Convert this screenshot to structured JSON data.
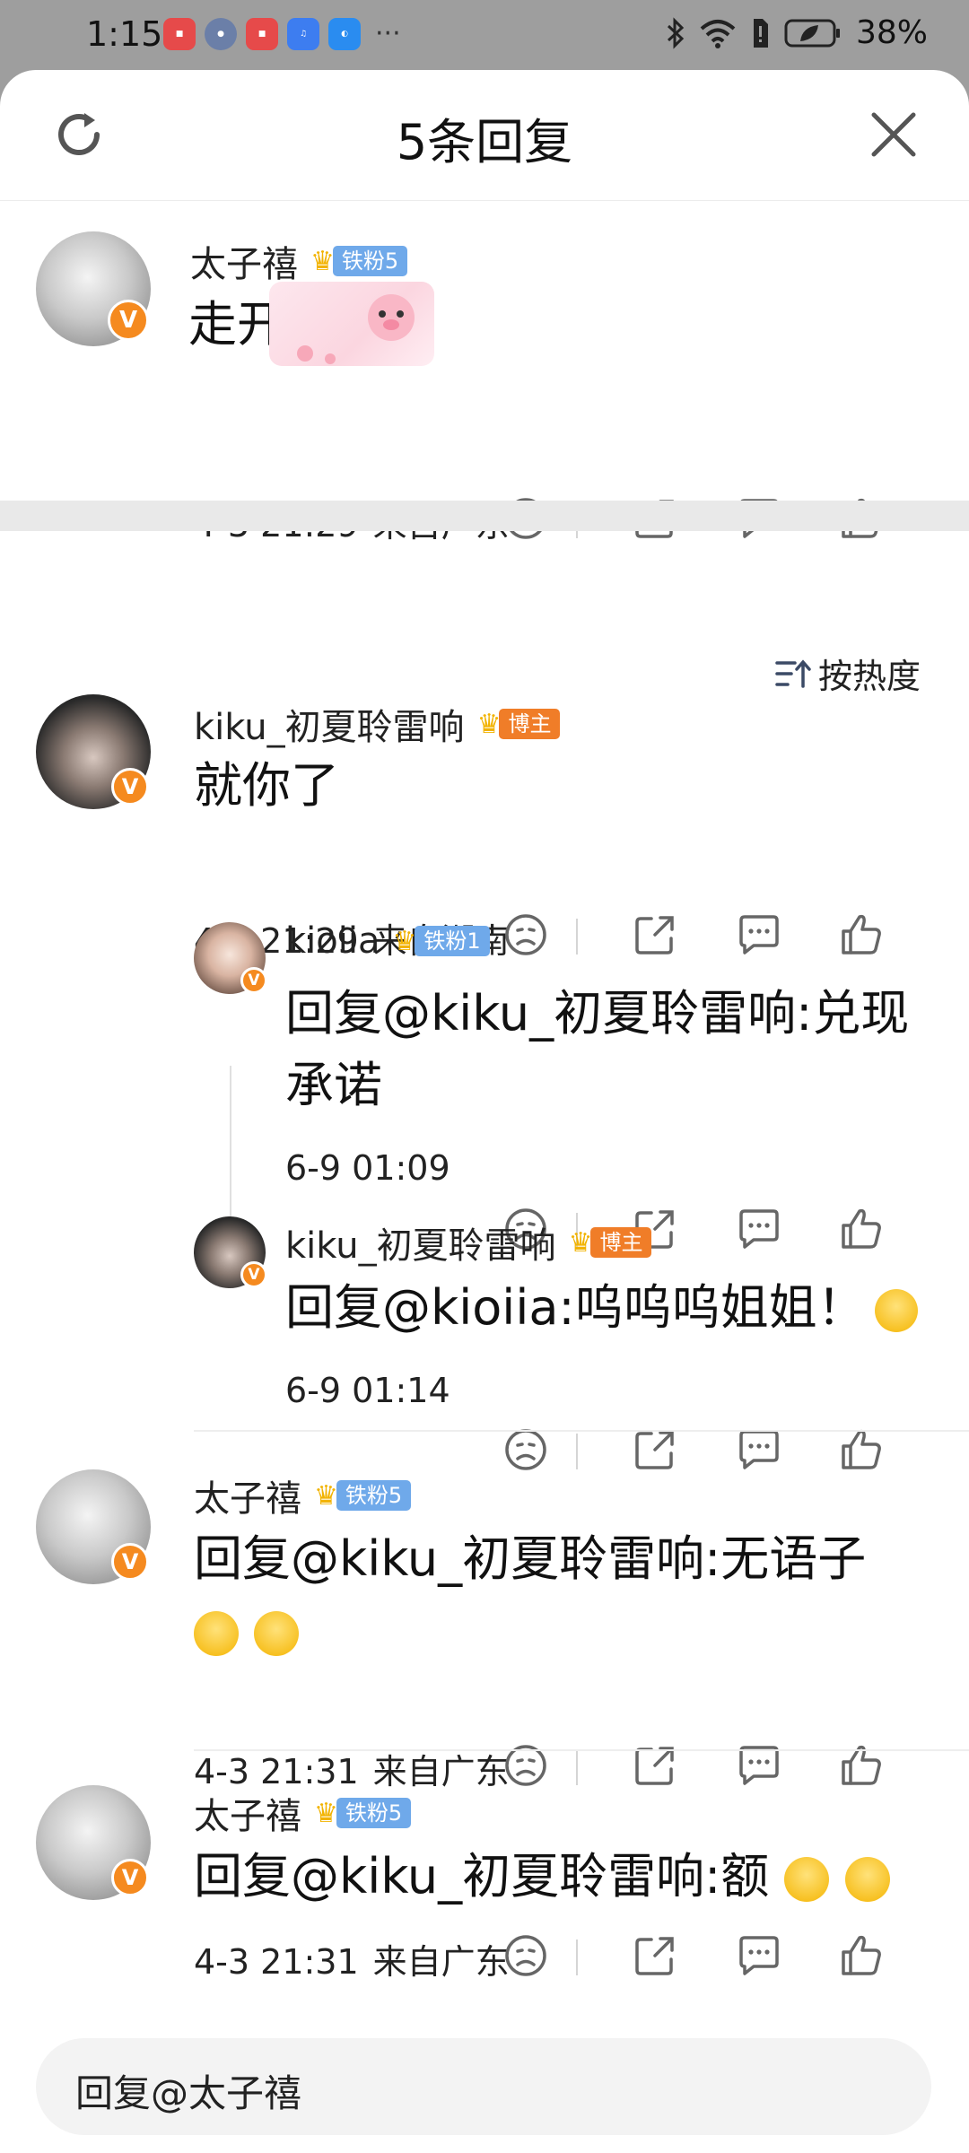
{
  "status_bar": {
    "time": "1:15",
    "battery": "38%",
    "more": "···"
  },
  "header": {
    "title": "5条回复"
  },
  "sort": {
    "label": "按热度"
  },
  "main_comment": {
    "user": "太子禧",
    "badge": "铁粉5",
    "text": "走开点",
    "time": "4-3 21:29",
    "location": "来自广东"
  },
  "comments": [
    {
      "user": "kiku_初夏聆雷响",
      "badge": "博主",
      "text": "就你了",
      "time": "4-3 21:29",
      "location": "来自湖南"
    },
    {
      "user": "kioiia",
      "badge": "铁粉1",
      "text": "回复@kiku_初夏聆雷响:兑现承诺",
      "time": "6-9 01:09"
    },
    {
      "user": "kiku_初夏聆雷响",
      "badge": "博主",
      "text": "回复@kioiia:呜呜呜姐姐！",
      "time": "6-9 01:14"
    },
    {
      "user": "太子禧",
      "badge": "铁粉5",
      "text": "回复@kiku_初夏聆雷响:无语子",
      "time": "4-3 21:31",
      "location": "来自广东"
    },
    {
      "user": "太子禧",
      "badge": "铁粉5",
      "text": "回复@kiku_初夏聆雷响:额",
      "time": "4-3 21:31",
      "location": "来自广东"
    }
  ],
  "reply_input": {
    "placeholder": "回复@太子禧"
  },
  "colors": {
    "fan_badge": "#6fa9ea",
    "blogger_badge": "#f07d28",
    "verified": "#f58a1f"
  }
}
